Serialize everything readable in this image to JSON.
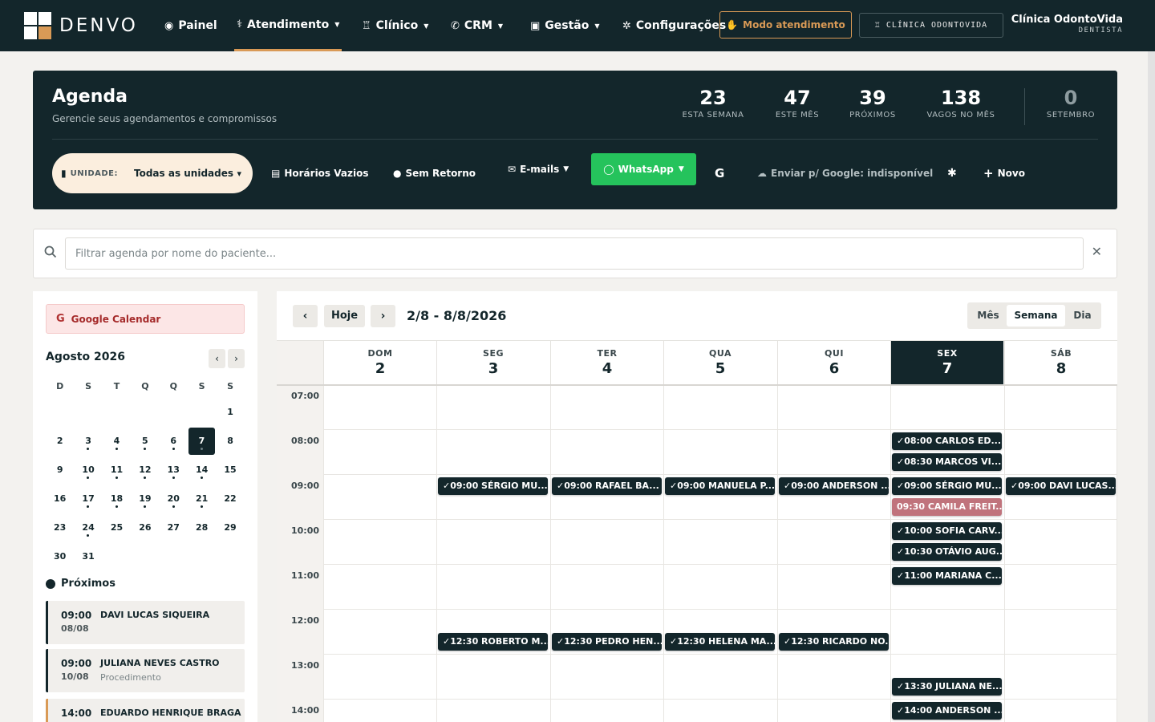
{
  "brand": {
    "name": "DENVO"
  },
  "nav": [
    {
      "label": "Painel",
      "icon": "dashboard-icon",
      "glyph": "◉",
      "chevron": false
    },
    {
      "label": "Atendimento",
      "icon": "stethoscope-icon",
      "glyph": "⚕",
      "chevron": true,
      "active": true
    },
    {
      "label": "Clínico",
      "icon": "tooth-icon",
      "glyph": "♖",
      "chevron": true
    },
    {
      "label": "CRM",
      "icon": "megaphone-icon",
      "glyph": "✆",
      "chevron": true
    },
    {
      "label": "Gestão",
      "icon": "briefcase-icon",
      "glyph": "▣",
      "chevron": true
    },
    {
      "label": "Configurações",
      "icon": "gear-icon",
      "glyph": "✲",
      "chevron": false
    }
  ],
  "modo_atendimento": "Modo atendimento",
  "clinic_button": "CLÍNICA ODONTOVIDA",
  "user": {
    "name": "Clínica OdontoVida",
    "role": "DENTISTA"
  },
  "agenda": {
    "title": "Agenda",
    "subtitle": "Gerencie seus agendamentos e compromissos",
    "stats": [
      {
        "value": "23",
        "label": "ESTA SEMANA"
      },
      {
        "value": "47",
        "label": "ESTE MÊS"
      },
      {
        "value": "39",
        "label": "PRÓXIMOS"
      },
      {
        "value": "138",
        "label": "VAGOS NO MÊS"
      },
      {
        "value": "0",
        "label": "SETEMBRO"
      }
    ],
    "unit": {
      "label": "UNIDADE:",
      "value": "Todas as unidades"
    },
    "tools": {
      "horarios": "Horários Vazios",
      "sem_retorno": "Sem Retorno",
      "emails": "E-mails",
      "whatsapp": "WhatsApp",
      "google_letter": "G",
      "enviar_google": "Enviar p/ Google: indisponível",
      "novo": "Novo"
    }
  },
  "search": {
    "placeholder": "Filtrar agenda por nome do paciente...",
    "value": ""
  },
  "sidebar": {
    "google_calendar": "Google Calendar",
    "month_title": "Agosto 2026",
    "weekdays": [
      "D",
      "S",
      "T",
      "Q",
      "Q",
      "S",
      "S"
    ],
    "weeks": [
      [
        null,
        null,
        null,
        null,
        null,
        null,
        1
      ],
      [
        2,
        3,
        4,
        5,
        6,
        7,
        8
      ],
      [
        9,
        10,
        11,
        12,
        13,
        14,
        15
      ],
      [
        16,
        17,
        18,
        19,
        20,
        21,
        22
      ],
      [
        23,
        24,
        25,
        26,
        27,
        28,
        29
      ],
      [
        30,
        31,
        null,
        null,
        null,
        null,
        null
      ]
    ],
    "selected_day": 7,
    "days_with_events": [
      3,
      4,
      5,
      6,
      7,
      10,
      11,
      12,
      13,
      14,
      17,
      18,
      19,
      20,
      21,
      24
    ],
    "proximos_title": "Próximos",
    "proximos": [
      {
        "time": "09:00",
        "date": "08/08",
        "name": "DAVI LUCAS SIQUEIRA",
        "sub": ""
      },
      {
        "time": "09:00",
        "date": "10/08",
        "name": "JULIANA NEVES CASTRO",
        "sub": "Procedimento"
      },
      {
        "time": "14:00",
        "date": "",
        "name": "EDUARDO HENRIQUE BRAGA",
        "sub": "",
        "accent": "orange"
      }
    ]
  },
  "calendar": {
    "today_label": "Hoje",
    "range": "2/8 - 8/8/2026",
    "views": [
      "Mês",
      "Semana",
      "Dia"
    ],
    "active_view": "Semana",
    "days": [
      {
        "weekday": "DOM",
        "day": "2"
      },
      {
        "weekday": "SEG",
        "day": "3"
      },
      {
        "weekday": "TER",
        "day": "4"
      },
      {
        "weekday": "QUA",
        "day": "5"
      },
      {
        "weekday": "QUI",
        "day": "6"
      },
      {
        "weekday": "SEX",
        "day": "7",
        "today": true
      },
      {
        "weekday": "SÁB",
        "day": "8"
      }
    ],
    "hours": [
      "07:00",
      "08:00",
      "09:00",
      "10:00",
      "11:00",
      "12:00",
      "13:00",
      "14:00"
    ],
    "events": [
      {
        "day": 5,
        "time": "08:00",
        "label": "✓08:00 CARLOS ED..."
      },
      {
        "day": 5,
        "time": "08:30",
        "label": "✓08:30 MARCOS VI..."
      },
      {
        "day": 1,
        "time": "09:00",
        "label": "✓09:00 SÉRGIO MU..."
      },
      {
        "day": 2,
        "time": "09:00",
        "label": "✓09:00 RAFAEL BA..."
      },
      {
        "day": 3,
        "time": "09:00",
        "label": "✓09:00 MANUELA P..."
      },
      {
        "day": 4,
        "time": "09:00",
        "label": "✓09:00 ANDERSON ..."
      },
      {
        "day": 5,
        "time": "09:00",
        "label": "✓09:00 SÉRGIO MU..."
      },
      {
        "day": 6,
        "time": "09:00",
        "label": "✓09:00 DAVI LUCAS..."
      },
      {
        "day": 5,
        "time": "09:30",
        "label": "09:30 CAMILA FREIT...",
        "color": "pink"
      },
      {
        "day": 5,
        "time": "10:00",
        "label": "✓10:00 SOFIA CARV..."
      },
      {
        "day": 5,
        "time": "10:30",
        "label": "✓10:30 OTÁVIO AUG..."
      },
      {
        "day": 5,
        "time": "11:00",
        "label": "✓11:00 MARIANA C..."
      },
      {
        "day": 1,
        "time": "12:30",
        "label": "✓12:30 ROBERTO M..."
      },
      {
        "day": 2,
        "time": "12:30",
        "label": "✓12:30 PEDRO HEN..."
      },
      {
        "day": 3,
        "time": "12:30",
        "label": "✓12:30 HELENA MA..."
      },
      {
        "day": 4,
        "time": "12:30",
        "label": "✓12:30 RICARDO NO..."
      },
      {
        "day": 5,
        "time": "13:30",
        "label": "✓13:30 JULIANA NE..."
      },
      {
        "day": 5,
        "time": "14:00",
        "label": "✓14:00 ANDERSON ..."
      }
    ]
  },
  "colors": {
    "primary": "#13262b",
    "accent": "#d99a56",
    "whatsapp": "#25c35c",
    "event_pending": "#c0737c"
  }
}
